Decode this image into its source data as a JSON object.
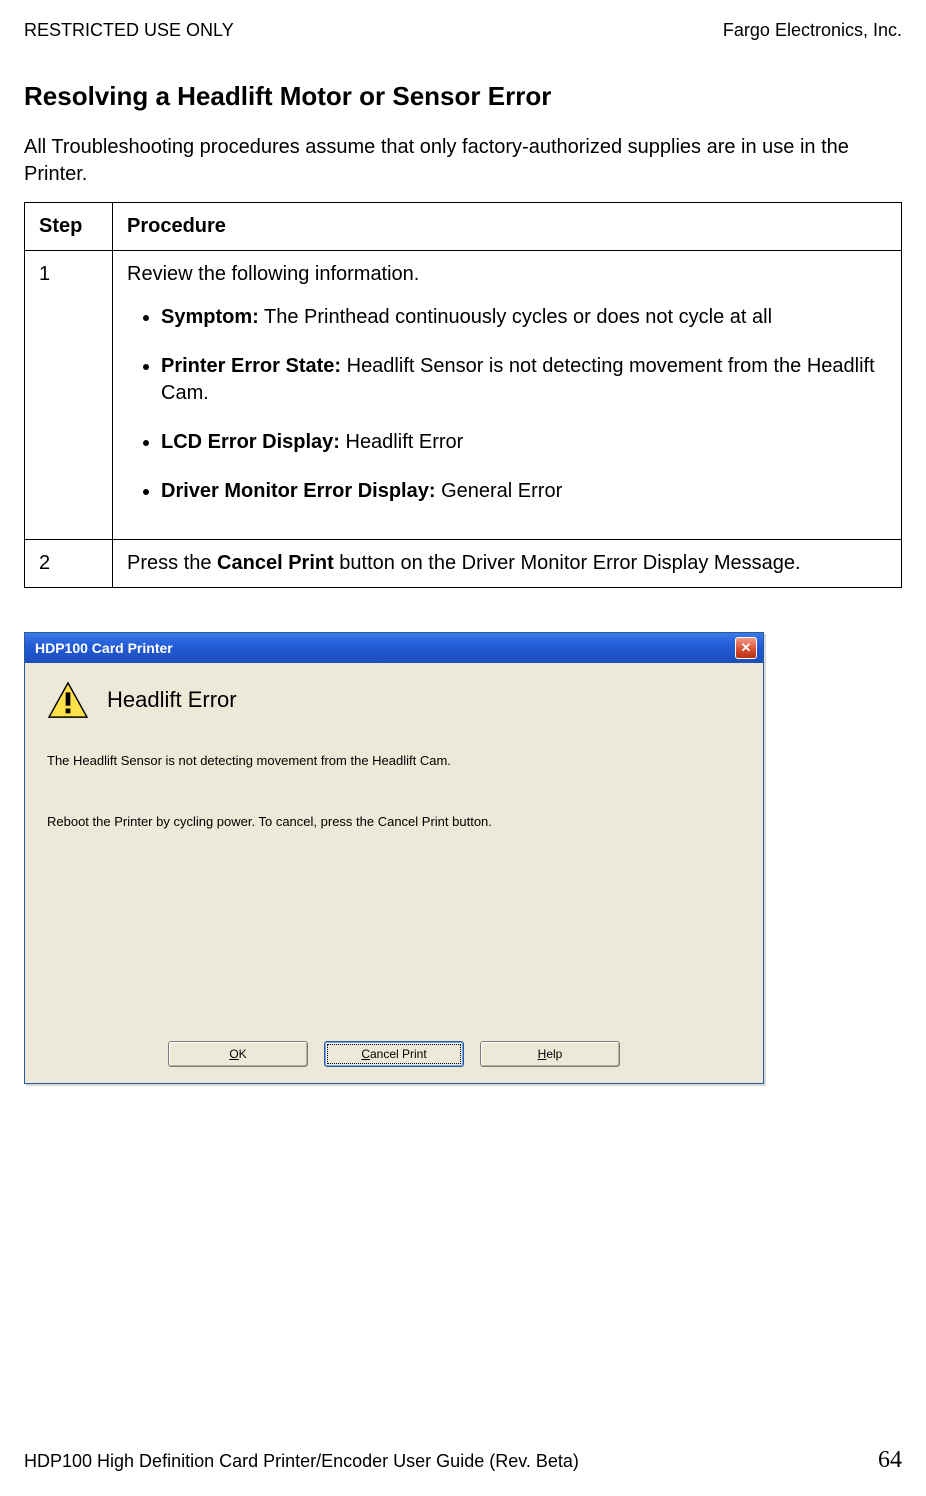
{
  "header": {
    "left": "RESTRICTED USE ONLY",
    "right": "Fargo Electronics, Inc."
  },
  "title": "Resolving a Headlift Motor or Sensor Error",
  "intro": "All Troubleshooting procedures assume that only factory-authorized supplies are in use in the Printer.",
  "table": {
    "head_step": "Step",
    "head_proc": "Procedure",
    "row1": {
      "num": "1",
      "lead": "Review the following information.",
      "b1_label": "Symptom:",
      "b1_text": " The Printhead continuously cycles or does not cycle at all",
      "b2_label": "Printer Error State:",
      "b2_text": " Headlift Sensor is not detecting movement from the Headlift Cam.",
      "b3_label": "LCD Error Display:",
      "b3_text": " Headlift Error",
      "b4_label": "Driver Monitor Error Display:",
      "b4_text": " General Error"
    },
    "row2": {
      "num": "2",
      "pre": "Press the ",
      "bold": "Cancel Print",
      "post": " button on the Driver Monitor Error Display Message."
    }
  },
  "dialog": {
    "title": "HDP100 Card Printer",
    "close_glyph": "✕",
    "error_title": "Headlift Error",
    "line1": "The Headlift Sensor is not detecting movement from the Headlift Cam.",
    "line2": "Reboot the Printer by cycling power. To cancel, press the Cancel Print button.",
    "btn_ok": "OK",
    "btn_cancel": "Cancel Print",
    "btn_help": "Help"
  },
  "footer": {
    "left": "HDP100 High Definition Card Printer/Encoder User Guide (Rev. Beta)",
    "page": "64"
  }
}
